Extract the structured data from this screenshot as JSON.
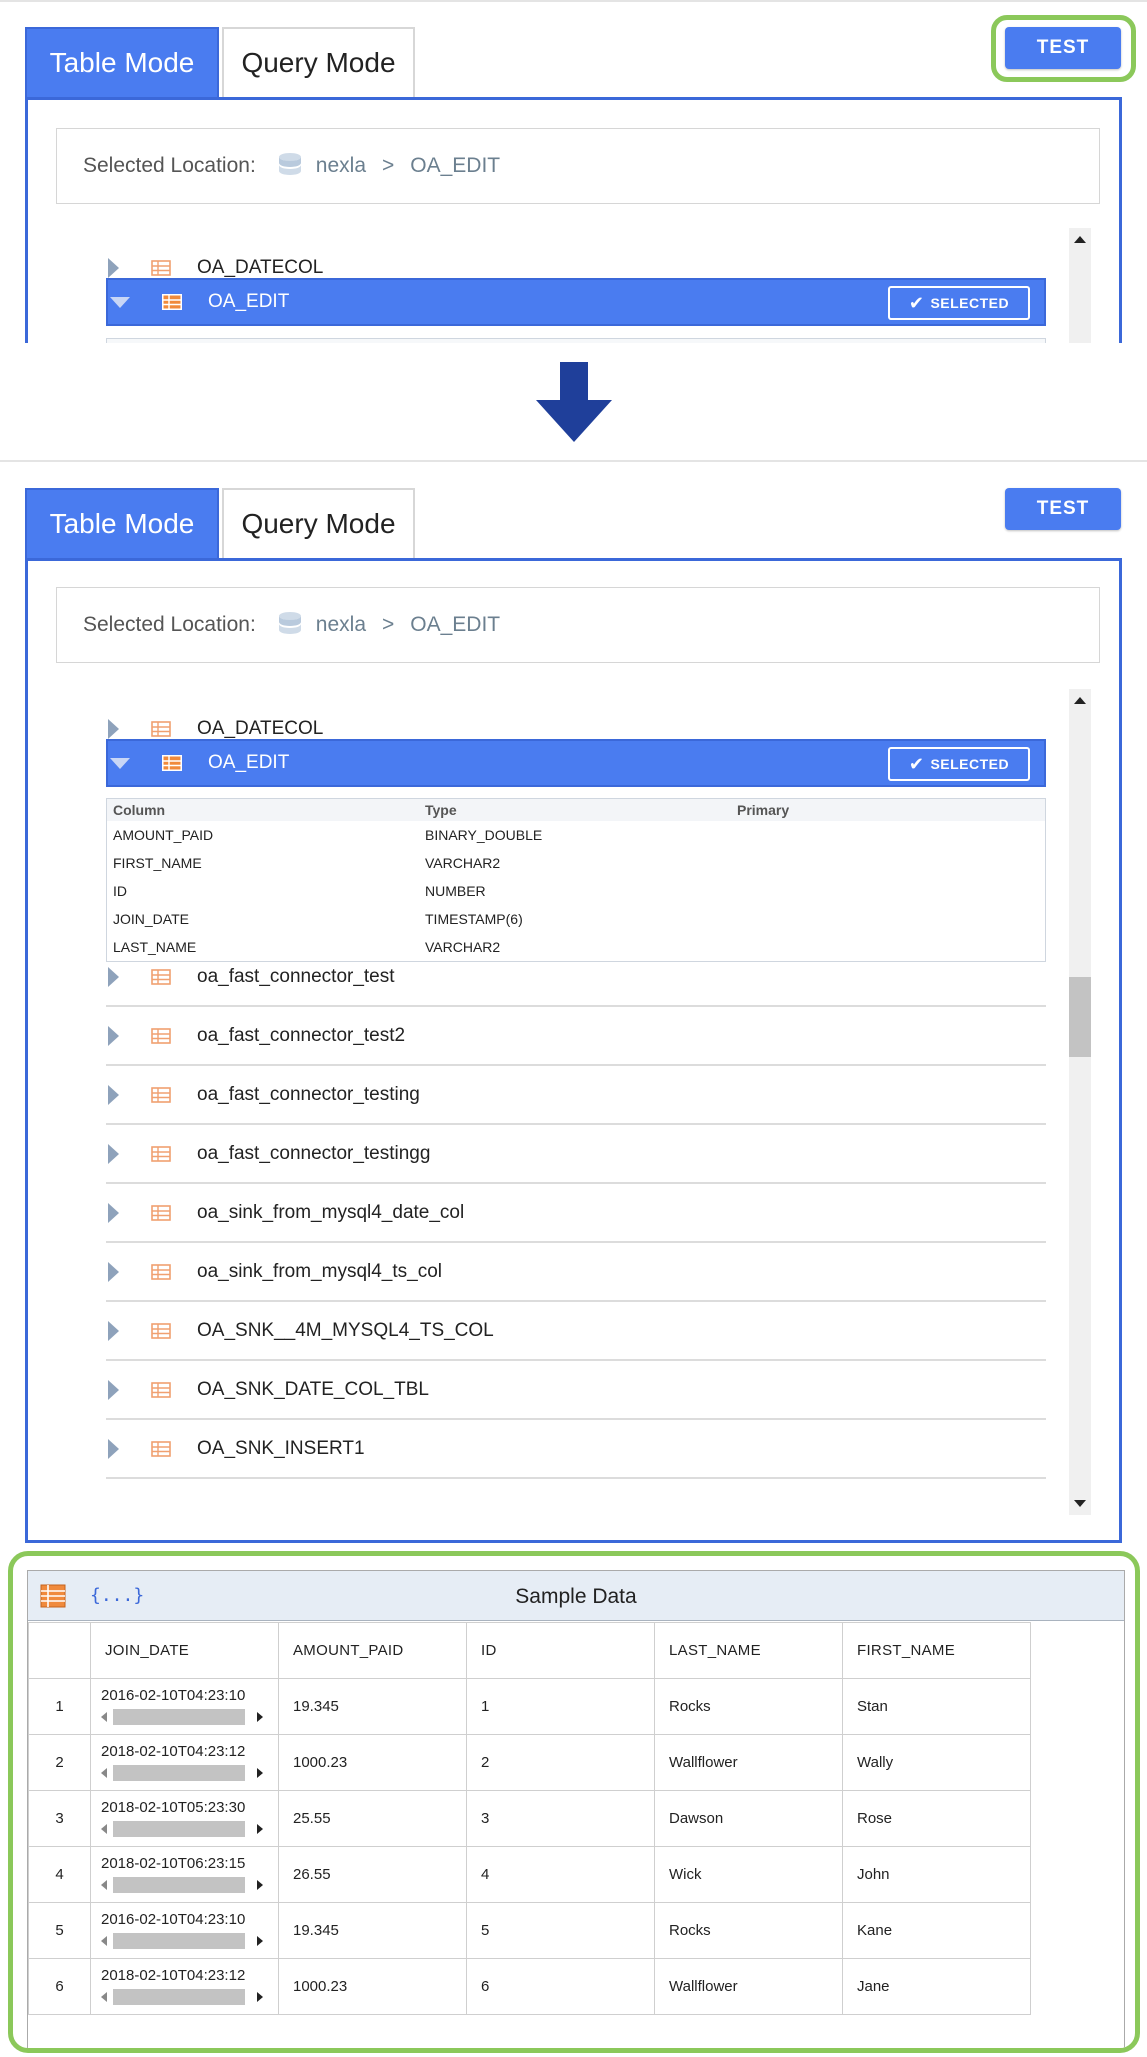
{
  "colors": {
    "accent": "#4a7cf0",
    "highlight": "#8bc85a",
    "arrow": "#1f3f9a"
  },
  "tabs": {
    "table_mode": "Table Mode",
    "query_mode": "Query Mode"
  },
  "test_button": "TEST",
  "location": {
    "label": "Selected Location:",
    "db": "nexla",
    "separator": ">",
    "table": "OA_EDIT"
  },
  "selected_badge": "SELECTED",
  "before": {
    "rows": [
      {
        "name": "OA_DATECOL"
      }
    ],
    "selected_row": "OA_EDIT"
  },
  "after": {
    "rows_above": [
      {
        "name": "OA_DATECOL"
      }
    ],
    "selected_row": "OA_EDIT",
    "columns_header": {
      "column": "Column",
      "type": "Type",
      "primary": "Primary"
    },
    "columns": [
      {
        "column": "AMOUNT_PAID",
        "type": "BINARY_DOUBLE",
        "primary": ""
      },
      {
        "column": "FIRST_NAME",
        "type": "VARCHAR2",
        "primary": ""
      },
      {
        "column": "ID",
        "type": "NUMBER",
        "primary": ""
      },
      {
        "column": "JOIN_DATE",
        "type": "TIMESTAMP(6)",
        "primary": ""
      },
      {
        "column": "LAST_NAME",
        "type": "VARCHAR2",
        "primary": ""
      }
    ],
    "rows_below": [
      {
        "name": "oa_fast_connector_test"
      },
      {
        "name": "oa_fast_connector_test2"
      },
      {
        "name": "oa_fast_connector_testing"
      },
      {
        "name": "oa_fast_connector_testingg"
      },
      {
        "name": "oa_sink_from_mysql4_date_col"
      },
      {
        "name": "oa_sink_from_mysql4_ts_col"
      },
      {
        "name": "OA_SNK__4M_MYSQL4_TS_COL"
      },
      {
        "name": "OA_SNK_DATE_COL_TBL"
      },
      {
        "name": "OA_SNK_INSERT1"
      }
    ]
  },
  "sample_data": {
    "title": "Sample Data",
    "json_icon": "{...}",
    "headers": [
      "JOIN_DATE",
      "AMOUNT_PAID",
      "ID",
      "LAST_NAME",
      "FIRST_NAME"
    ],
    "rows": [
      {
        "idx": "1",
        "join_date": "2016-02-10T04:23:10",
        "amount_paid": "19.345",
        "id": "1",
        "last_name": "Rocks",
        "first_name": "Stan"
      },
      {
        "idx": "2",
        "join_date": "2018-02-10T04:23:12",
        "amount_paid": "1000.23",
        "id": "2",
        "last_name": "Wallflower",
        "first_name": "Wally"
      },
      {
        "idx": "3",
        "join_date": "2018-02-10T05:23:30",
        "amount_paid": "25.55",
        "id": "3",
        "last_name": "Dawson",
        "first_name": "Rose"
      },
      {
        "idx": "4",
        "join_date": "2018-02-10T06:23:15",
        "amount_paid": "26.55",
        "id": "4",
        "last_name": "Wick",
        "first_name": "John"
      },
      {
        "idx": "5",
        "join_date": "2016-02-10T04:23:10",
        "amount_paid": "19.345",
        "id": "5",
        "last_name": "Rocks",
        "first_name": "Kane"
      },
      {
        "idx": "6",
        "join_date": "2018-02-10T04:23:12",
        "amount_paid": "1000.23",
        "id": "6",
        "last_name": "Wallflower",
        "first_name": "Jane"
      }
    ]
  }
}
